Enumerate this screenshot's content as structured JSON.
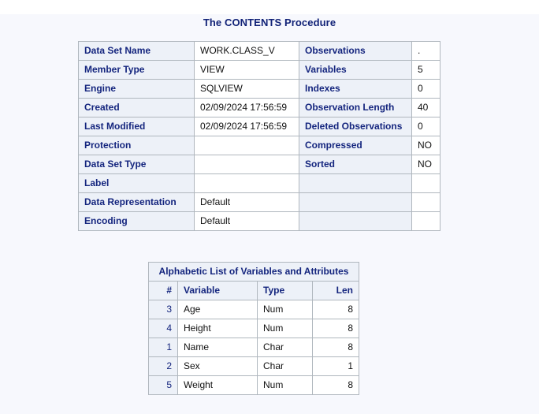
{
  "page": {
    "background": "#f7f8fd",
    "accent": "#14257e"
  },
  "title": "The CONTENTS Procedure",
  "attributes_table": {
    "name": "data-set-attributes",
    "rows": [
      {
        "label1": "Data Set Name",
        "value1": "WORK.CLASS_V",
        "label2": "Observations",
        "value2": "."
      },
      {
        "label1": "Member Type",
        "value1": "VIEW",
        "label2": "Variables",
        "value2": "5"
      },
      {
        "label1": "Engine",
        "value1": "SQLVIEW",
        "label2": "Indexes",
        "value2": "0"
      },
      {
        "label1": "Created",
        "value1": "02/09/2024 17:56:59",
        "label2": "Observation Length",
        "value2": "40"
      },
      {
        "label1": "Last Modified",
        "value1": "02/09/2024 17:56:59",
        "label2": "Deleted Observations",
        "value2": "0"
      },
      {
        "label1": "Protection",
        "value1": "",
        "label2": "Compressed",
        "value2": "NO"
      },
      {
        "label1": "Data Set Type",
        "value1": "",
        "label2": "Sorted",
        "value2": "NO"
      },
      {
        "label1": "Label",
        "value1": "",
        "label2": "",
        "value2": ""
      },
      {
        "label1": "Data Representation",
        "value1": "Default",
        "label2": "",
        "value2": ""
      },
      {
        "label1": "Encoding",
        "value1": "Default",
        "label2": "",
        "value2": ""
      }
    ]
  },
  "variables_table": {
    "caption": "Alphabetic List of Variables and Attributes",
    "headers": {
      "num": "#",
      "variable": "Variable",
      "type": "Type",
      "len": "Len"
    },
    "rows": [
      {
        "num": "3",
        "variable": "Age",
        "type": "Num",
        "len": "8"
      },
      {
        "num": "4",
        "variable": "Height",
        "type": "Num",
        "len": "8"
      },
      {
        "num": "1",
        "variable": "Name",
        "type": "Char",
        "len": "8"
      },
      {
        "num": "2",
        "variable": "Sex",
        "type": "Char",
        "len": "1"
      },
      {
        "num": "5",
        "variable": "Weight",
        "type": "Num",
        "len": "8"
      }
    ]
  }
}
